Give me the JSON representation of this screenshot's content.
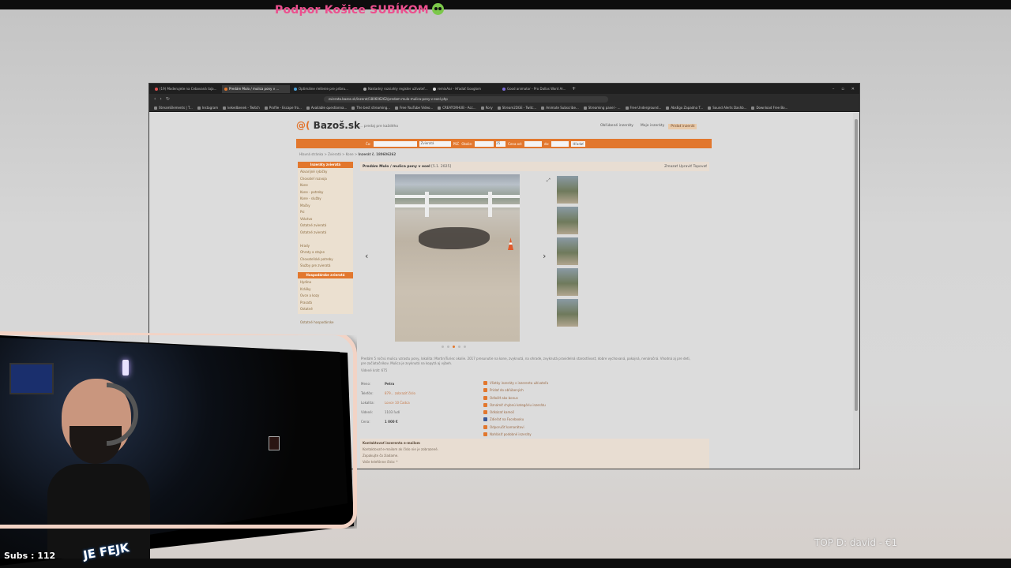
{
  "stream": {
    "banner": "Podpor Košice SUBÍKOM",
    "subs": "Subs : 112",
    "top_donation": "TOP D: david - €1",
    "overlay_badge": "JE FEJK"
  },
  "browser": {
    "tabs": [
      {
        "label": "(19) Moderujete na Cebovaná taja...",
        "color": "#e05050"
      },
      {
        "label": "Predám Mulo / mulica pony v ...",
        "color": "#e2772d",
        "active": true
      },
      {
        "label": "Optimálne riešenie pre pribru...",
        "color": "#4aa0d8"
      },
      {
        "label": "Nakladný rozsiahly register užívateľ...",
        "color": "#aaaaaa"
      },
      {
        "label": "remixAar - Hľadať Googlom",
        "color": "#dddddd"
      },
      {
        "label": "Good animator - Pro Dallas Word Ar...",
        "color": "#7a6ad8"
      }
    ],
    "url": "zvierata.bazos.sk/inzerat/180606262/predam-mulo-mulica-pony-v-eoel.php",
    "bookmarks": [
      "StreamElements | T...",
      "Instagram",
      "kekedbenek - Twitch",
      "Profile - Escape fro...",
      "Available questionna...",
      "The best streaming...",
      "Free YouTube Video...",
      "CREATORHUB - Acc...",
      "Rory",
      "Stream2DGE - Twitc...",
      "Animate Subscribe...",
      "Streaming panel - ...",
      "Free Underground...",
      "AbsEgo Zapadna T...",
      "Sound Alerts Dashb...",
      "Download Free Bo..."
    ]
  },
  "site": {
    "logo": "Bazoš.sk",
    "logo_at": "@(",
    "tagline": "... predaj pre každého",
    "top_links": [
      "Obľúbené inzeráty",
      "Moje inzeráty",
      "Pridať inzerát"
    ],
    "search": {
      "what": "Čo:",
      "category": "Zvieratá",
      "psc": "PSČ",
      "okolie": "Okolie:",
      "km": "25",
      "price_from": "Cena od:",
      "price_to": "do:",
      "button": "Hľadať"
    },
    "breadcrumb": "Hlavná stránka > Zvieratá > Kone >",
    "breadcrumb_current": "Inzerát č. 180606262",
    "sidebar": {
      "heading": "Inzeráty zvieratá",
      "items": [
        "Akvarijné rybičky",
        "Chovateľ rozvoja",
        "Kone",
        "Kone - potreby",
        "Kone - služby",
        "Mačky",
        "Psi",
        "Vtáctvo",
        "Ostatné zvieratá",
        "Ostatné zvieratá",
        "Hrady",
        "Ohraty a stajne",
        "Chovateľské potreby",
        "Služby pre zvieratá"
      ],
      "heading2": "Hospodárske zvieratá",
      "items2": [
        "Hydina",
        "Králiky",
        "Ovce a kozy",
        "Prasatá",
        "Ostatné"
      ],
      "footer": "Ostatné hospodárske"
    },
    "ad": {
      "title": "Predám Mulo / mulica pony v eoel",
      "meta": "[5.1. 2025]",
      "actions_right": "Zmazať Upraviť Topovať",
      "description": "Predám 5 ročnú mulicu vzrastu pony, lokalita: Martin/Turiec okolie. 2017 presunutie na kone, zvyknutá, na ohrade, zvyknutá pravidelná starostlivosť, dobre vychovaná, pokojná, nenáročná. Vhodná aj pre deti, pre začiatočníkov. Mulica je zvyknutá na kopytá aj výbeh.",
      "views": "Videné krát: 675",
      "details": [
        {
          "label": "Meno:",
          "value": "Petra"
        },
        {
          "label": "Telefón:",
          "value": "879... zobraziť číslo"
        },
        {
          "label": "Lokalita:",
          "value": "Lovce 10 Čadca"
        },
        {
          "label": "Videné:",
          "value": "1103 ľudí"
        },
        {
          "label": "Cena:",
          "value": "1 000 €"
        }
      ],
      "actions": [
        "Všetky inzeráty s inzerenta užívateľa",
        "Pridať do obľúbených",
        "Odložiť ako bonus",
        "Oznámiť chybnú kategóriu inzerátu",
        "Odkázať kamoš",
        "Zdieľať na Facebooku",
        "Odporučiť kamarátovi",
        "Nahlásiť podobné inzeráty"
      ],
      "contact": {
        "heading": "Kontaktovať inzerenta e-mailom",
        "line1": "Kontaktovať e-mailom ak číslo nie je zobrazené.",
        "line2": "Zopakujte čo žiadame.",
        "field": "Vaše telefónne číslo: *"
      }
    }
  }
}
